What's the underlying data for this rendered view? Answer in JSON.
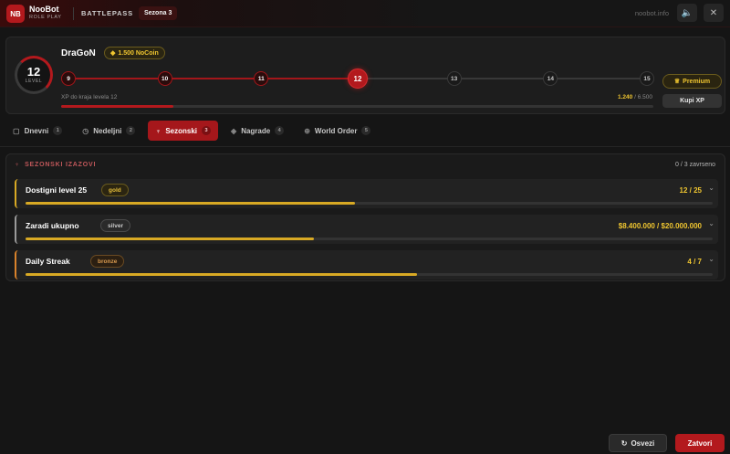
{
  "header": {
    "logo": "NB",
    "brand_name": "NooBot",
    "brand_sub": "ROLE PLAY",
    "section": "BATTLEPASS",
    "season": "Sezona 3",
    "site": "noobot.info",
    "sound_icon": "speaker-icon",
    "close_icon": "close-icon",
    "sound_glyph": "🔈",
    "close_glyph": "✕"
  },
  "profile": {
    "level": "12",
    "level_word": "LEVEL",
    "player": "DraGoN",
    "coins": "1.500 NoCoin",
    "coin_glyph": "◆",
    "nodes": [
      "9",
      "10",
      "11",
      "12",
      "13",
      "14",
      "15"
    ],
    "current_level": 12,
    "xp_label": "XP do kraja levela 12",
    "xp_current": "1.240",
    "xp_total": "/ 6.500",
    "xp_fraction": 0.19,
    "premium": "Premium",
    "premium_glyph": "♕",
    "buy_xp": "Kupi XP"
  },
  "tabs": [
    {
      "label": "Dnevni",
      "count": "1",
      "icon": "calendar-icon",
      "glyph": "▢",
      "active": false
    },
    {
      "label": "Nedeljni",
      "count": "2",
      "icon": "clock-icon",
      "glyph": "◷",
      "active": false
    },
    {
      "label": "Sezonski",
      "count": "3",
      "icon": "trophy-icon",
      "glyph": "♆",
      "active": true
    },
    {
      "label": "Nagrade",
      "count": "4",
      "icon": "gem-icon",
      "glyph": "◈",
      "active": false
    },
    {
      "label": "World Order",
      "count": "5",
      "icon": "globe-icon",
      "glyph": "⊕",
      "active": false
    }
  ],
  "panel": {
    "title": "SEZONSKI IZAZOVI",
    "title_glyph": "♆",
    "count": "0 / 3 zavrseno",
    "challenges": [
      {
        "name": "Dostigni level 25",
        "tier": "gold",
        "progress": "12 / 25",
        "fraction": 0.48,
        "accent": "#d8a924"
      },
      {
        "name": "Zaradi ukupno",
        "tier": "silver",
        "progress": "$8.400.000 / $20.000.000",
        "fraction": 0.42,
        "accent": "#9a9a9a"
      },
      {
        "name": "Daily Streak",
        "tier": "bronze",
        "progress": "4 / 7",
        "fraction": 0.57,
        "accent": "#d9822b"
      }
    ],
    "chevron_glyph": "⌄"
  },
  "footer": {
    "refresh": "Osvezi",
    "refresh_glyph": "↻",
    "close": "Zatvori"
  }
}
